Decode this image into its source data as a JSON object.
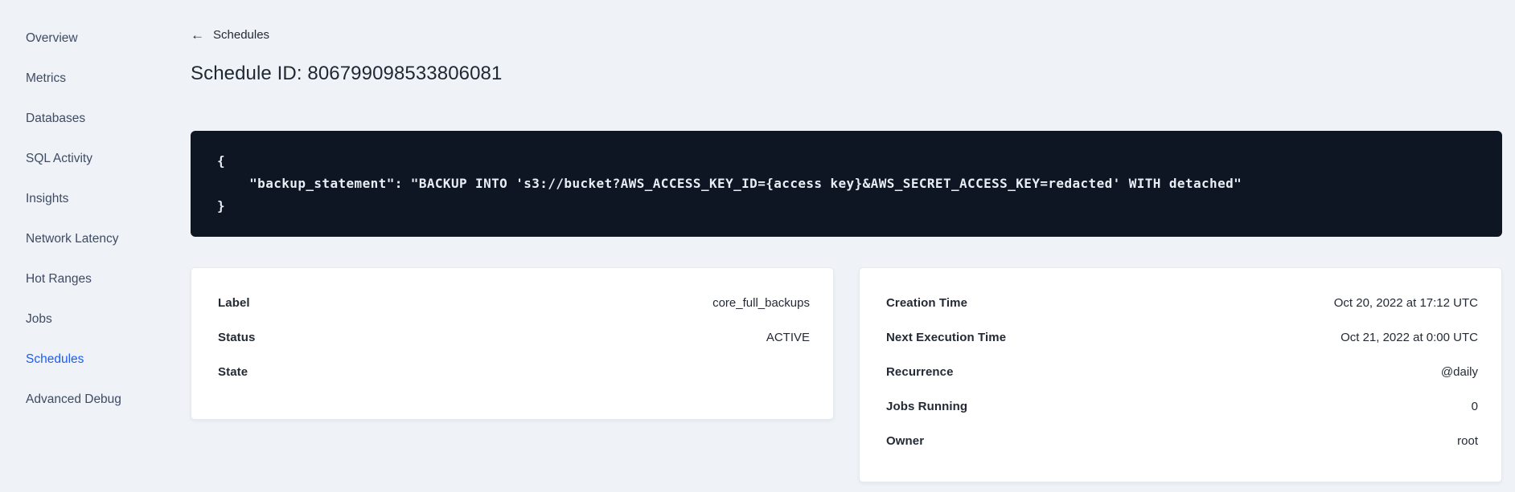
{
  "sidebar": {
    "items": [
      {
        "label": "Overview",
        "active": false
      },
      {
        "label": "Metrics",
        "active": false
      },
      {
        "label": "Databases",
        "active": false
      },
      {
        "label": "SQL Activity",
        "active": false
      },
      {
        "label": "Insights",
        "active": false
      },
      {
        "label": "Network Latency",
        "active": false
      },
      {
        "label": "Hot Ranges",
        "active": false
      },
      {
        "label": "Jobs",
        "active": false
      },
      {
        "label": "Schedules",
        "active": true
      },
      {
        "label": "Advanced Debug",
        "active": false
      }
    ]
  },
  "header": {
    "back_label": "Schedules",
    "title": "Schedule ID: 806799098533806081"
  },
  "icons": {
    "back_arrow": "←"
  },
  "code_block": {
    "text": "{\n    \"backup_statement\": \"BACKUP INTO 's3://bucket?AWS_ACCESS_KEY_ID={access key}&AWS_SECRET_ACCESS_KEY=redacted' WITH detached\"\n}"
  },
  "details_card": {
    "rows": [
      {
        "label": "Label",
        "value": "core_full_backups"
      },
      {
        "label": "Status",
        "value": "ACTIVE"
      },
      {
        "label": "State",
        "value": ""
      }
    ]
  },
  "schedule_card": {
    "rows": [
      {
        "label": "Creation Time",
        "value": "Oct 20, 2022 at 17:12 UTC"
      },
      {
        "label": "Next Execution Time",
        "value": "Oct 21, 2022 at 0:00 UTC"
      },
      {
        "label": "Recurrence",
        "value": "@daily"
      },
      {
        "label": "Jobs Running",
        "value": "0"
      },
      {
        "label": "Owner",
        "value": "root"
      }
    ]
  },
  "colors": {
    "page_bg": "#eff3f7",
    "card_bg": "#ffffff",
    "code_bg": "#0e1523",
    "code_text": "#e9eef5",
    "text_dark": "#242a35",
    "sidebar_text": "#3e4b63",
    "accent_blue": "#1d5cf2"
  }
}
